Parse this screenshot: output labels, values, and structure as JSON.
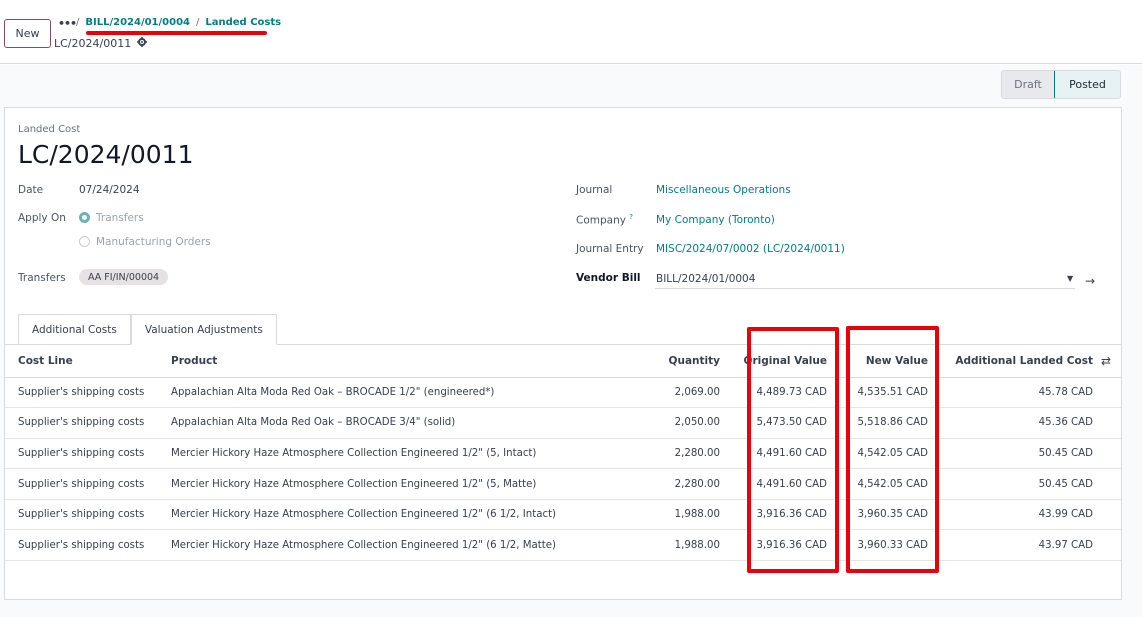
{
  "controlpanel": {
    "new_label": "New",
    "menu_dots": "•••",
    "breadcrumb_sep": "/",
    "breadcrumb": [
      "BILL/2024/01/0004",
      "Landed Costs"
    ],
    "record_name": "LC/2024/0011"
  },
  "statusbar": {
    "draft": "Draft",
    "posted": "Posted"
  },
  "form": {
    "header_label": "Landed Cost",
    "title": "LC/2024/0011",
    "date_label": "Date",
    "date_value": "07/24/2024",
    "apply_on_label": "Apply On",
    "apply_on_options": [
      "Transfers",
      "Manufacturing Orders"
    ],
    "transfers_label": "Transfers",
    "transfer_tag": "AA FI/IN/00004",
    "journal_label": "Journal",
    "journal_value": "Miscellaneous Operations",
    "company_label": "Company",
    "company_help": "?",
    "company_value": "My Company (Toronto)",
    "journal_entry_label": "Journal Entry",
    "journal_entry_value": "MISC/2024/07/0002 (LC/2024/0011)",
    "vendor_bill_label": "Vendor Bill",
    "vendor_bill_value": "BILL/2024/01/0004"
  },
  "tabs": [
    "Additional Costs",
    "Valuation Adjustments"
  ],
  "table": {
    "headers": [
      "Cost Line",
      "Product",
      "Quantity",
      "Original Value",
      "New Value",
      "Additional Landed Cost"
    ],
    "rows": [
      [
        "Supplier's shipping costs",
        "Appalachian Alta Moda Red Oak – BROCADE 1/2\" (engineered*)",
        "2,069.00",
        "4,489.73 CAD",
        "4,535.51 CAD",
        "45.78 CAD"
      ],
      [
        "Supplier's shipping costs",
        "Appalachian Alta Moda Red Oak – BROCADE 3/4\" (solid)",
        "2,050.00",
        "5,473.50 CAD",
        "5,518.86 CAD",
        "45.36 CAD"
      ],
      [
        "Supplier's shipping costs",
        "Mercier Hickory Haze Atmosphere Collection Engineered 1/2\" (5, Intact)",
        "2,280.00",
        "4,491.60 CAD",
        "4,542.05 CAD",
        "50.45 CAD"
      ],
      [
        "Supplier's shipping costs",
        "Mercier Hickory Haze Atmosphere Collection Engineered 1/2\" (5, Matte)",
        "2,280.00",
        "4,491.60 CAD",
        "4,542.05 CAD",
        "50.45 CAD"
      ],
      [
        "Supplier's shipping costs",
        "Mercier Hickory Haze Atmosphere Collection Engineered 1/2\" (6 1/2, Intact)",
        "1,988.00",
        "3,916.36 CAD",
        "3,960.35 CAD",
        "43.99 CAD"
      ],
      [
        "Supplier's shipping costs",
        "Mercier Hickory Haze Atmosphere Collection Engineered 1/2\" (6 1/2, Matte)",
        "1,988.00",
        "3,916.36 CAD",
        "3,960.33 CAD",
        "43.97 CAD"
      ]
    ]
  },
  "colors": {
    "accent": "#017e84",
    "highlight": "#e8000c",
    "new_button_border": "#8a4a5e"
  },
  "icons": [
    "gear-icon",
    "chevron-down-icon",
    "arrow-right-icon",
    "optional-columns-icon"
  ]
}
